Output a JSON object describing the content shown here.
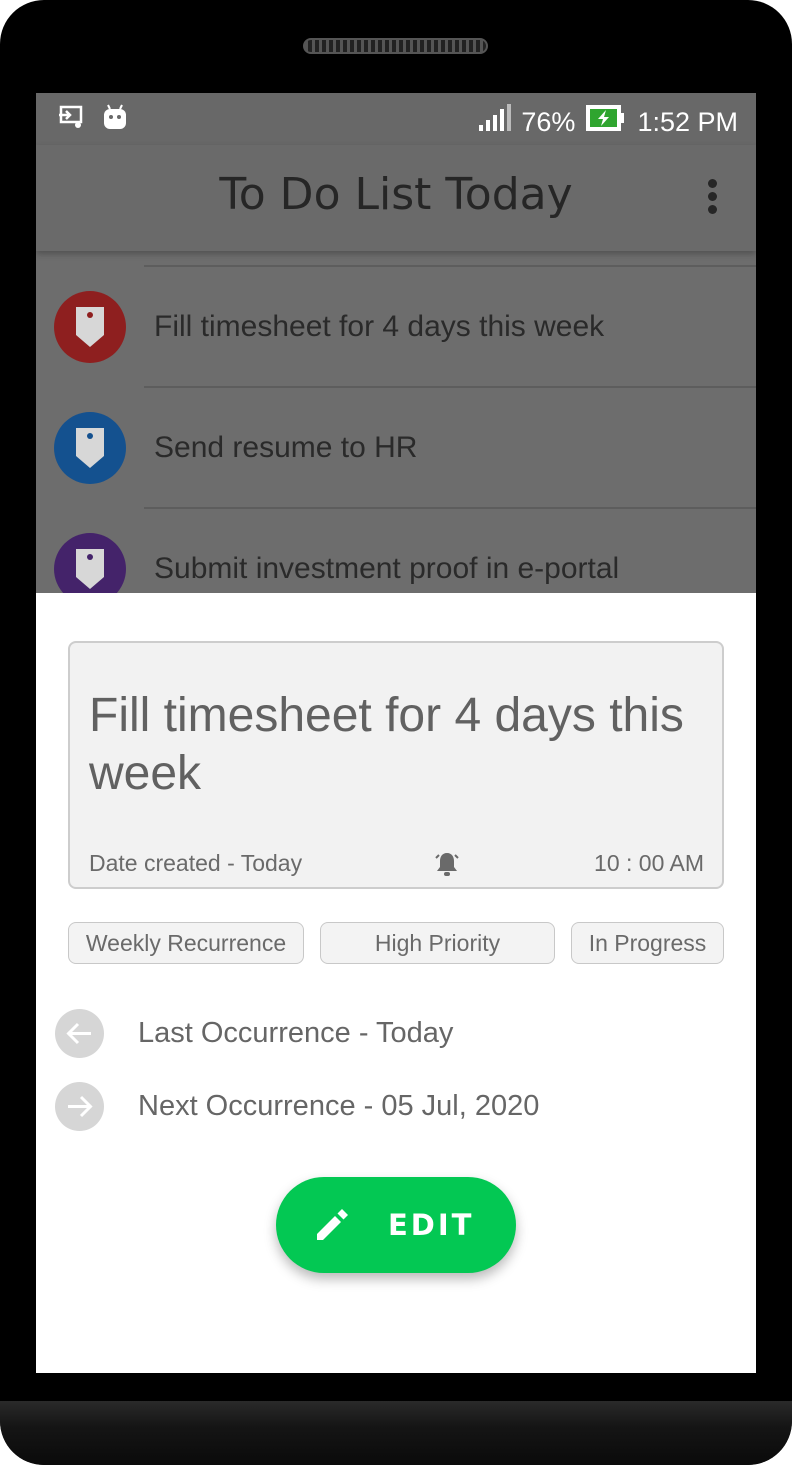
{
  "status_bar": {
    "icons": [
      "screen-cast-icon",
      "android-icon",
      "signal-icon",
      "battery-charging-icon"
    ],
    "battery": "76%",
    "time": "1:52 PM"
  },
  "app_bar": {
    "title": "To Do List Today",
    "overflow_icon": "more-vert-icon"
  },
  "tasks": [
    {
      "label": "Fill timesheet for 4 days this week",
      "color": "#b22222"
    },
    {
      "label": "Send resume to HR",
      "color": "#1565c0"
    },
    {
      "label": "Submit investment proof in e-portal",
      "color": "#5b2c8f"
    }
  ],
  "detail": {
    "title": "Fill timesheet for 4 days this week",
    "date_created": "Date created - Today",
    "reminder_icon": "alarm-bell-icon",
    "time": "10 : 00 AM",
    "chips": [
      "Weekly Recurrence",
      "High Priority",
      "In Progress"
    ],
    "last_occurrence": "Last Occurrence - Today",
    "next_occurrence": "Next Occurrence - 05 Jul, 2020",
    "edit_label": "EDIT",
    "accent": "#03c853"
  }
}
